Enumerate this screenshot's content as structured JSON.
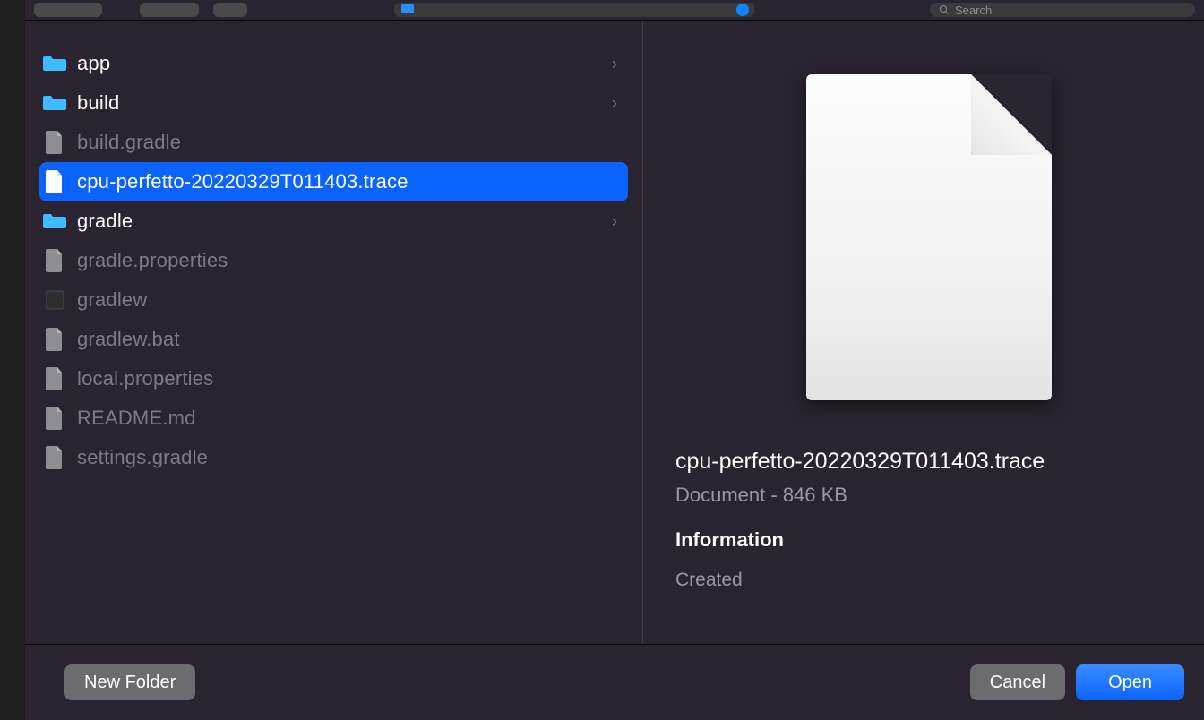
{
  "toolbar": {
    "search_placeholder": "Search"
  },
  "files": [
    {
      "name": "app",
      "type": "folder",
      "enabled": true,
      "selected": false
    },
    {
      "name": "build",
      "type": "folder",
      "enabled": true,
      "selected": false
    },
    {
      "name": "build.gradle",
      "type": "file",
      "enabled": false,
      "selected": false
    },
    {
      "name": "cpu-perfetto-20220329T011403.trace",
      "type": "file",
      "enabled": true,
      "selected": true
    },
    {
      "name": "gradle",
      "type": "folder",
      "enabled": true,
      "selected": false
    },
    {
      "name": "gradle.properties",
      "type": "file",
      "enabled": false,
      "selected": false
    },
    {
      "name": "gradlew",
      "type": "exec",
      "enabled": false,
      "selected": false
    },
    {
      "name": "gradlew.bat",
      "type": "file",
      "enabled": false,
      "selected": false
    },
    {
      "name": "local.properties",
      "type": "file",
      "enabled": false,
      "selected": false
    },
    {
      "name": "README.md",
      "type": "file",
      "enabled": false,
      "selected": false
    },
    {
      "name": "settings.gradle",
      "type": "file",
      "enabled": false,
      "selected": false
    }
  ],
  "preview": {
    "filename": "cpu-perfetto-20220329T011403.trace",
    "subtitle": "Document - 846 KB",
    "info_header": "Information",
    "created_label": "Created"
  },
  "footer": {
    "new_folder": "New Folder",
    "cancel": "Cancel",
    "open": "Open"
  }
}
